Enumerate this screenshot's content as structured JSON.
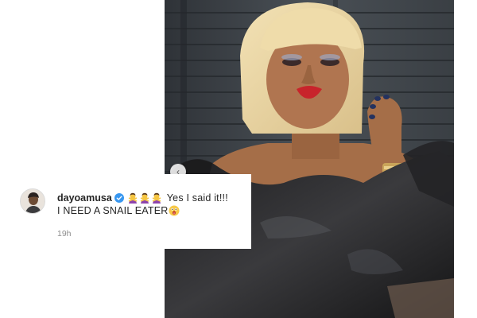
{
  "post": {
    "image_alt": "Woman with blonde bob wig, red lipstick, black satin off-shoulder dress"
  },
  "comment": {
    "username": "dayoamusa",
    "verified": true,
    "emojis": [
      "woman-gesturing-no",
      "woman-gesturing-no",
      "woman-gesturing-no"
    ],
    "text_line1": "Yes I said it!!!",
    "text_line2": "I NEED A SNAIL EATER",
    "trailing_emoji": "face-with-open-mouth",
    "timestamp": "19h"
  },
  "colors": {
    "verified_blue": "#3897f0",
    "text": "#262626",
    "muted": "#8e8e8e"
  }
}
